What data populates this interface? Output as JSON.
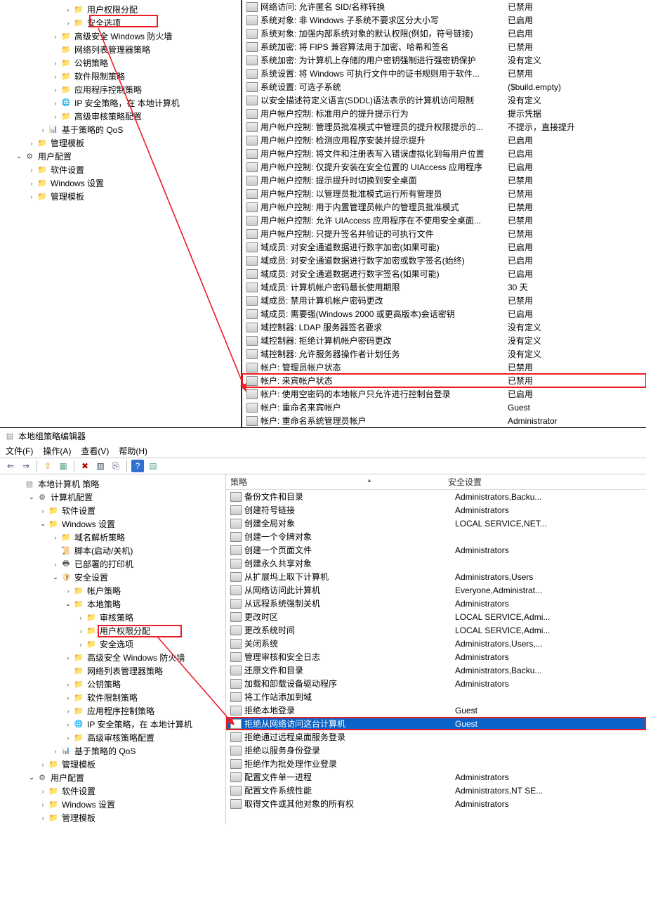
{
  "top_tree": [
    {
      "indent": 3,
      "chev": ">",
      "icon": "folder-shield",
      "label": "用户权限分配"
    },
    {
      "indent": 3,
      "chev": ">",
      "icon": "folder-shield",
      "label": "安全选项",
      "boxed": true
    },
    {
      "indent": 2,
      "chev": ">",
      "icon": "folder",
      "label": "高级安全 Windows 防火墙"
    },
    {
      "indent": 2,
      "chev": "",
      "icon": "folder",
      "label": "网络列表管理器策略"
    },
    {
      "indent": 2,
      "chev": ">",
      "icon": "folder",
      "label": "公钥策略"
    },
    {
      "indent": 2,
      "chev": ">",
      "icon": "folder",
      "label": "软件限制策略"
    },
    {
      "indent": 2,
      "chev": ">",
      "icon": "folder",
      "label": "应用程序控制策略"
    },
    {
      "indent": 2,
      "chev": ">",
      "icon": "ip",
      "label": "IP 安全策略，在 本地计算机"
    },
    {
      "indent": 2,
      "chev": ">",
      "icon": "folder",
      "label": "高级审核策略配置"
    },
    {
      "indent": 1,
      "chev": ">",
      "icon": "qos",
      "label": "基于策略的 QoS"
    },
    {
      "indent": 0,
      "chev": ">",
      "icon": "folder",
      "label": "管理模板"
    },
    {
      "indent": -1,
      "chev": "v",
      "icon": "gear",
      "label": "用户配置",
      "open": true
    },
    {
      "indent": 0,
      "chev": ">",
      "icon": "folder",
      "label": "软件设置"
    },
    {
      "indent": 0,
      "chev": ">",
      "icon": "folder",
      "label": "Windows 设置"
    },
    {
      "indent": 0,
      "chev": ">",
      "icon": "folder",
      "label": "管理模板"
    }
  ],
  "top_policies": [
    {
      "label": "网络访问: 允许匿名 SID/名称转换",
      "value": "已禁用"
    },
    {
      "label": "系统对象: 非 Windows 子系统不要求区分大小写",
      "value": "已启用"
    },
    {
      "label": "系统对象: 加强内部系统对象的默认权限(例如，符号链接)",
      "value": "已启用"
    },
    {
      "label": "系统加密: 将 FIPS 兼容算法用于加密、哈希和签名",
      "value": "已禁用"
    },
    {
      "label": "系统加密: 为计算机上存储的用户密钥强制进行强密钥保护",
      "value": "没有定义"
    },
    {
      "label": "系统设置: 将 Windows 可执行文件中的证书规则用于软件...",
      "value": "已禁用"
    },
    {
      "label": "系统设置: 可选子系统",
      "value": "($build.empty)"
    },
    {
      "label": "以安全描述符定义语言(SDDL)语法表示的计算机访问限制",
      "value": "没有定义"
    },
    {
      "label": "用户帐户控制: 标准用户的提升提示行为",
      "value": "提示凭据"
    },
    {
      "label": "用户帐户控制: 管理员批准模式中管理员的提升权限提示的...",
      "value": "不提示，直接提升"
    },
    {
      "label": "用户帐户控制: 检测应用程序安装并提示提升",
      "value": "已启用"
    },
    {
      "label": "用户帐户控制: 将文件和注册表写入错误虚拟化到每用户位置",
      "value": "已启用"
    },
    {
      "label": "用户帐户控制: 仅提升安装在安全位置的 UIAccess 应用程序",
      "value": "已启用"
    },
    {
      "label": "用户帐户控制: 提示提升时切换到安全桌面",
      "value": "已禁用"
    },
    {
      "label": "用户帐户控制: 以管理员批准模式运行所有管理员",
      "value": "已禁用"
    },
    {
      "label": "用户帐户控制: 用于内置管理员帐户的管理员批准模式",
      "value": "已禁用"
    },
    {
      "label": "用户帐户控制: 允许 UIAccess 应用程序在不使用安全桌面...",
      "value": "已禁用"
    },
    {
      "label": "用户帐户控制: 只提升签名并验证的可执行文件",
      "value": "已禁用"
    },
    {
      "label": "域成员: 对安全通道数据进行数字加密(如果可能)",
      "value": "已启用"
    },
    {
      "label": "域成员: 对安全通道数据进行数字加密或数字签名(始终)",
      "value": "已启用"
    },
    {
      "label": "域成员: 对安全通道数据进行数字签名(如果可能)",
      "value": "已启用"
    },
    {
      "label": "域成员: 计算机帐户密码最长使用期限",
      "value": "30 天"
    },
    {
      "label": "域成员: 禁用计算机帐户密码更改",
      "value": "已禁用"
    },
    {
      "label": "域成员: 需要强(Windows 2000 或更高版本)会话密钥",
      "value": "已启用"
    },
    {
      "label": "域控制器: LDAP 服务器签名要求",
      "value": "没有定义"
    },
    {
      "label": "域控制器: 拒绝计算机帐户密码更改",
      "value": "没有定义"
    },
    {
      "label": "域控制器: 允许服务器操作者计划任务",
      "value": "没有定义"
    },
    {
      "label": "帐户: 管理员帐户状态",
      "value": "已禁用"
    },
    {
      "label": "帐户: 来宾帐户状态",
      "value": "已禁用",
      "boxed": true
    },
    {
      "label": "帐户: 使用空密码的本地帐户只允许进行控制台登录",
      "value": "已启用"
    },
    {
      "label": "帐户: 重命名来宾帐户",
      "value": "Guest"
    },
    {
      "label": "帐户: 重命名系统管理员帐户",
      "value": "Administrator"
    }
  ],
  "window_title": "本地组策略编辑器",
  "menus": [
    "文件(F)",
    "操作(A)",
    "查看(V)",
    "帮助(H)"
  ],
  "bottom_tree": [
    {
      "indent": 0,
      "chev": "",
      "icon": "doc",
      "label": "本地计算机 策略"
    },
    {
      "indent": 1,
      "chev": "v",
      "icon": "gear",
      "label": "计算机配置"
    },
    {
      "indent": 2,
      "chev": ">",
      "icon": "folder",
      "label": "软件设置"
    },
    {
      "indent": 2,
      "chev": "v",
      "icon": "folder",
      "label": "Windows 设置"
    },
    {
      "indent": 3,
      "chev": ">",
      "icon": "folder",
      "label": "域名解析策略"
    },
    {
      "indent": 3,
      "chev": "",
      "icon": "script",
      "label": "脚本(启动/关机)"
    },
    {
      "indent": 3,
      "chev": ">",
      "icon": "printer",
      "label": "已部署的打印机"
    },
    {
      "indent": 3,
      "chev": "v",
      "icon": "shield",
      "label": "安全设置"
    },
    {
      "indent": 4,
      "chev": ">",
      "icon": "folder-shield",
      "label": "帐户策略"
    },
    {
      "indent": 4,
      "chev": "v",
      "icon": "folder-shield",
      "label": "本地策略"
    },
    {
      "indent": 5,
      "chev": ">",
      "icon": "folder-shield",
      "label": "审核策略"
    },
    {
      "indent": 5,
      "chev": ">",
      "icon": "folder-shield",
      "label": "用户权限分配",
      "boxed": true
    },
    {
      "indent": 5,
      "chev": ">",
      "icon": "folder-shield",
      "label": "安全选项"
    },
    {
      "indent": 4,
      "chev": ">",
      "icon": "folder",
      "label": "高级安全 Windows 防火墙"
    },
    {
      "indent": 4,
      "chev": "",
      "icon": "folder",
      "label": "网络列表管理器策略"
    },
    {
      "indent": 4,
      "chev": ">",
      "icon": "folder",
      "label": "公钥策略"
    },
    {
      "indent": 4,
      "chev": ">",
      "icon": "folder",
      "label": "软件限制策略"
    },
    {
      "indent": 4,
      "chev": ">",
      "icon": "folder",
      "label": "应用程序控制策略"
    },
    {
      "indent": 4,
      "chev": ">",
      "icon": "ip",
      "label": "IP 安全策略，在 本地计算机"
    },
    {
      "indent": 4,
      "chev": ">",
      "icon": "folder",
      "label": "高级审核策略配置"
    },
    {
      "indent": 3,
      "chev": ">",
      "icon": "qos",
      "label": "基于策略的 QoS"
    },
    {
      "indent": 2,
      "chev": ">",
      "icon": "folder",
      "label": "管理模板"
    },
    {
      "indent": 1,
      "chev": "v",
      "icon": "gear",
      "label": "用户配置"
    },
    {
      "indent": 2,
      "chev": ">",
      "icon": "folder",
      "label": "软件设置"
    },
    {
      "indent": 2,
      "chev": ">",
      "icon": "folder",
      "label": "Windows 设置"
    },
    {
      "indent": 2,
      "chev": ">",
      "icon": "folder",
      "label": "管理模板"
    }
  ],
  "bottom_headers": {
    "policy": "策略",
    "setting": "安全设置"
  },
  "bottom_policies": [
    {
      "label": "备份文件和目录",
      "value": "Administrators,Backu..."
    },
    {
      "label": "创建符号链接",
      "value": "Administrators"
    },
    {
      "label": "创建全局对象",
      "value": "LOCAL SERVICE,NET..."
    },
    {
      "label": "创建一个令牌对象",
      "value": ""
    },
    {
      "label": "创建一个页面文件",
      "value": "Administrators"
    },
    {
      "label": "创建永久共享对象",
      "value": ""
    },
    {
      "label": "从扩展坞上取下计算机",
      "value": "Administrators,Users"
    },
    {
      "label": "从网络访问此计算机",
      "value": "Everyone,Administrat..."
    },
    {
      "label": "从远程系统强制关机",
      "value": "Administrators"
    },
    {
      "label": "更改时区",
      "value": "LOCAL SERVICE,Admi..."
    },
    {
      "label": "更改系统时间",
      "value": "LOCAL SERVICE,Admi..."
    },
    {
      "label": "关闭系统",
      "value": "Administrators,Users,..."
    },
    {
      "label": "管理审核和安全日志",
      "value": "Administrators"
    },
    {
      "label": "还原文件和目录",
      "value": "Administrators,Backu..."
    },
    {
      "label": "加载和卸载设备驱动程序",
      "value": "Administrators"
    },
    {
      "label": "将工作站添加到域",
      "value": ""
    },
    {
      "label": "拒绝本地登录",
      "value": "Guest"
    },
    {
      "label": "拒绝从网络访问这台计算机",
      "value": "Guest",
      "sel": true,
      "boxed": true
    },
    {
      "label": "拒绝通过远程桌面服务登录",
      "value": ""
    },
    {
      "label": "拒绝以服务身份登录",
      "value": ""
    },
    {
      "label": "拒绝作为批处理作业登录",
      "value": ""
    },
    {
      "label": "配置文件单一进程",
      "value": "Administrators"
    },
    {
      "label": "配置文件系统性能",
      "value": "Administrators,NT SE..."
    },
    {
      "label": "取得文件或其他对象的所有权",
      "value": "Administrators"
    }
  ]
}
